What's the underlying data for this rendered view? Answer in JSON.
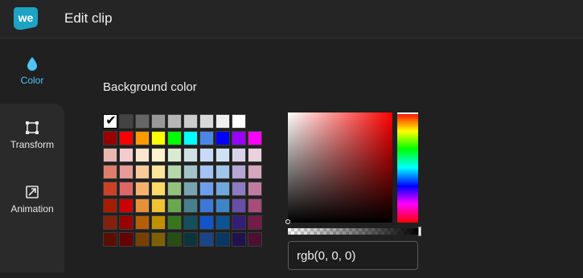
{
  "header": {
    "logo_text": "we",
    "title": "Edit clip"
  },
  "sidebar": {
    "items": [
      {
        "label": "Color",
        "icon": "droplet-icon",
        "active": true
      },
      {
        "label": "Transform",
        "icon": "transform-icon",
        "active": false
      },
      {
        "label": "Animation",
        "icon": "animation-icon",
        "active": false
      }
    ]
  },
  "color_panel": {
    "section_title": "Background color",
    "selected_swatch": "#000000",
    "swatch_rows": [
      [
        "#000000",
        "#434343",
        "#666666",
        "#999999",
        "#b7b7b7",
        "#cccccc",
        "#d9d9d9",
        "#efefef",
        "#ffffff"
      ],
      [
        "#980000",
        "#ff0000",
        "#ff9900",
        "#ffff00",
        "#00ff00",
        "#00ffff",
        "#4a86e8",
        "#0000ff",
        "#9900ff",
        "#ff00ff"
      ],
      [
        "#e6b8af",
        "#f4cccc",
        "#fce5cd",
        "#fff2cc",
        "#d9ead3",
        "#d0e0e3",
        "#c9daf8",
        "#cfe2f3",
        "#d9d2e9",
        "#ead1dc"
      ],
      [
        "#dd7e6b",
        "#ea9999",
        "#f9cb9c",
        "#ffe599",
        "#b6d7a8",
        "#a2c4c9",
        "#a4c2f4",
        "#9fc5e8",
        "#b4a7d6",
        "#d5a6bd"
      ],
      [
        "#cc4125",
        "#e06666",
        "#f6b26b",
        "#ffd966",
        "#93c47d",
        "#76a5af",
        "#6d9eeb",
        "#6fa8dc",
        "#8e7cc3",
        "#c27ba0"
      ],
      [
        "#a61c00",
        "#cc0000",
        "#e69138",
        "#f1c232",
        "#6aa84f",
        "#45818e",
        "#3c78d8",
        "#3d85c6",
        "#674ea7",
        "#a64d79"
      ],
      [
        "#85200c",
        "#990000",
        "#b45f06",
        "#bf9000",
        "#38761d",
        "#134f5c",
        "#1155cc",
        "#0b5394",
        "#351c75",
        "#741b47"
      ],
      [
        "#5b0f00",
        "#660000",
        "#783f04",
        "#7f6000",
        "#274e13",
        "#0c343d",
        "#1c4587",
        "#073763",
        "#20124d",
        "#4c1130"
      ]
    ],
    "picker": {
      "hue_color": "#ff0000",
      "value_text": "rgb(0, 0, 0)"
    }
  },
  "colors": {
    "accent": "#4fc3f7",
    "logo_bg": "#1fa3c4",
    "background": "#202020",
    "topbar": "#252525"
  }
}
